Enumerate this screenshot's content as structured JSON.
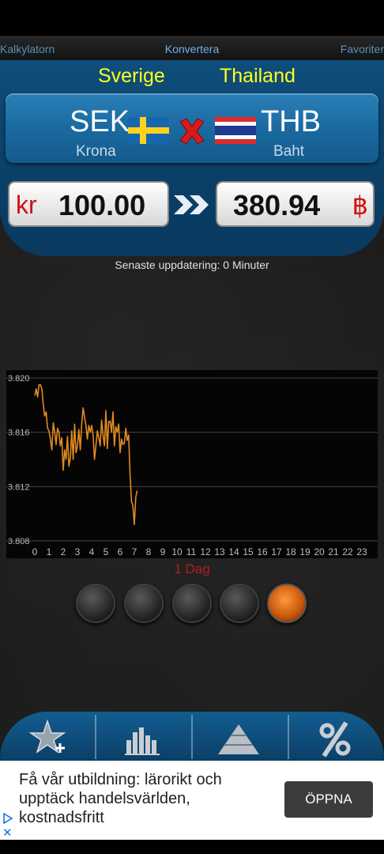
{
  "tabs": {
    "calculator": "Kalkylatorn",
    "convert": "Konvertera",
    "favorites": "Favoriter"
  },
  "from": {
    "country": "Sverige",
    "code": "SEK",
    "name": "Krona",
    "symbol": "kr",
    "amount": "100.00"
  },
  "to": {
    "country": "Thailand",
    "code": "THB",
    "name": "Baht",
    "symbol": "฿",
    "amount": "380.94"
  },
  "update_text": "Senaste uppdatering: 0 Minuter",
  "chart_data": {
    "type": "line",
    "title": "",
    "xlabel": "",
    "ylabel": "",
    "x_ticks": [
      "0",
      "1",
      "2",
      "3",
      "4",
      "5",
      "6",
      "7",
      "8",
      "9",
      "10",
      "11",
      "12",
      "13",
      "14",
      "15",
      "16",
      "17",
      "18",
      "19",
      "20",
      "21",
      "22",
      "23"
    ],
    "y_ticks": [
      "3.820",
      "3.816",
      "3.812",
      "3.808"
    ],
    "ylim": [
      3.808,
      3.82
    ],
    "xlim": [
      0,
      23.5
    ],
    "grid": true,
    "series": [
      {
        "color": "#e08a1e",
        "x": [
          0,
          0.1,
          0.2,
          0.3,
          0.4,
          0.5,
          0.6,
          0.7,
          0.8,
          0.9,
          1.0,
          1.1,
          1.2,
          1.3,
          1.4,
          1.5,
          1.6,
          1.7,
          1.8,
          1.9,
          2.0,
          2.1,
          2.2,
          2.3,
          2.4,
          2.5,
          2.6,
          2.7,
          2.8,
          2.9,
          3.0,
          3.1,
          3.2,
          3.3,
          3.4,
          3.5,
          3.6,
          3.7,
          3.8,
          3.9,
          4.0,
          4.1,
          4.2,
          4.3,
          4.4,
          4.5,
          4.6,
          4.7,
          4.8,
          4.9,
          5.0,
          5.1,
          5.2,
          5.3,
          5.4,
          5.5,
          5.6,
          5.7,
          5.8,
          5.9,
          6.0,
          6.1,
          6.2,
          6.3,
          6.4,
          6.5,
          6.6,
          6.7,
          6.8,
          6.9,
          7.0,
          7.1,
          7.2
        ],
        "values": [
          3.8187,
          3.8192,
          3.8186,
          3.8195,
          3.8195,
          3.8192,
          3.818,
          3.8172,
          3.8175,
          3.8163,
          3.8161,
          3.8155,
          3.8147,
          3.8167,
          3.816,
          3.8151,
          3.8163,
          3.816,
          3.815,
          3.8156,
          3.8132,
          3.8147,
          3.814,
          3.8157,
          3.8135,
          3.8141,
          3.8161,
          3.814,
          3.8166,
          3.8145,
          3.815,
          3.8162,
          3.8147,
          3.8166,
          3.8178,
          3.8171,
          3.8165,
          3.8155,
          3.8165,
          3.816,
          3.8165,
          3.8158,
          3.814,
          3.815,
          3.8161,
          3.8156,
          3.815,
          3.8169,
          3.8158,
          3.815,
          3.8176,
          3.8148,
          3.8168,
          3.8168,
          3.816,
          3.8175,
          3.815,
          3.8164,
          3.816,
          3.8166,
          3.8145,
          3.8155,
          3.8151,
          3.8152,
          3.8163,
          3.8154,
          3.8158,
          3.8129,
          3.8109,
          3.8106,
          3.8092,
          3.8112,
          3.8117
        ]
      }
    ]
  },
  "chart_period": "1 Dag",
  "period_buttons": [
    {
      "active": false
    },
    {
      "active": false
    },
    {
      "active": false
    },
    {
      "active": false
    },
    {
      "active": true
    }
  ],
  "ad": {
    "text": "Få vår utbildning: lärorikt och upptäck handelsvärlden, kostnadsfritt",
    "button": "ÖPPNA",
    "close": "✕"
  },
  "icons": [
    "add-favorite-icon",
    "chart-icon",
    "pyramid-icon",
    "percent-icon",
    "swap-icon",
    "flag-se-icon",
    "flag-th-icon",
    "double-arrow-icon",
    "ad-play-icon"
  ]
}
